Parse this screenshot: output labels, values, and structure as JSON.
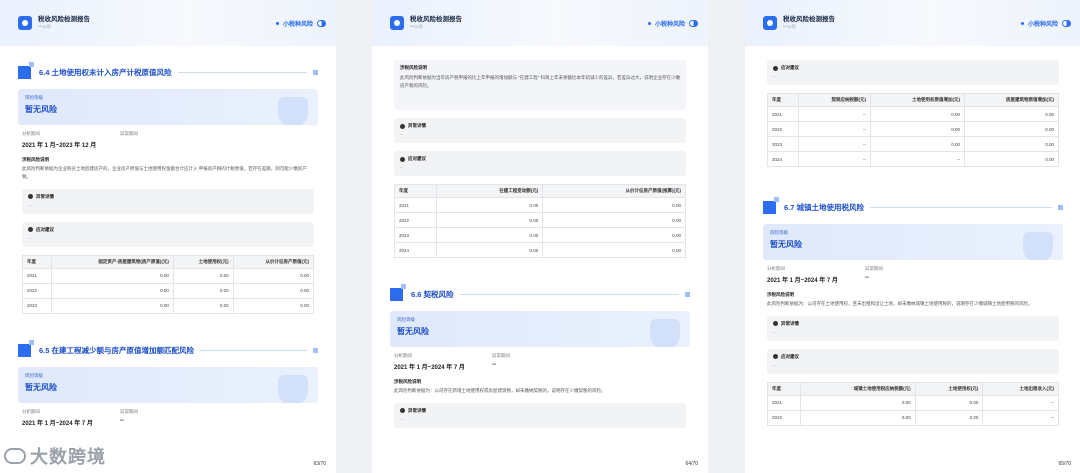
{
  "header": {
    "title": "税收风险检测报告",
    "subtitle": "***公司",
    "badge": "小税种风险"
  },
  "common": {
    "risk_level_label": "风险等级",
    "period_label": "分析期间",
    "abnormal_label": "异常期间",
    "desc_label": "涉税风险说明",
    "detail_label": "异常详情",
    "advice_label": "应对建议",
    "dash": "--"
  },
  "p1": {
    "sec1_title": "6.4 土地使用权未计入房产计税原值风险",
    "sec1_risk": "暂无风险",
    "sec1_period": "2021 年 1 月~2023 年 12 月",
    "sec1_abnormal": "",
    "sec1_desc": "此风险判断依据为企业购买土地后建房产的，企业房产原值与土地使用权金额合计应计入 申报房产税的计税原值，若存在差额，则可能少缴房产税。",
    "table_headers": [
      "年度",
      "固定资产-房屋建筑物(房产原值)(元)",
      "土地使用权(元)",
      "从价计征房产原值(元)"
    ],
    "table_rows": [
      [
        "2021",
        "0.00",
        "0.00",
        "0.00"
      ],
      [
        "2022",
        "0.00",
        "0.00",
        "0.00"
      ],
      [
        "2023",
        "0.00",
        "0.00",
        "0.00"
      ]
    ],
    "sec2_title": "6.5 在建工程减少额与房产原值增加额匹配风险",
    "sec2_risk": "暂无风险",
    "sec2_period": "2021 年 1 月~2024 年 7 月",
    "sec2_abnormal": "--",
    "page_number": "63/70"
  },
  "p2": {
    "desc": "此风险判断依据为当年房产税申报的比上年申报的增加额与 “在建工程” 科目上年末余额比本年初减少的差异，若差异过大，说明企业存在少缴房产税的风险。",
    "table_headers": [
      "年度",
      "在建工程变动额(元)",
      "从价计征房产原值(推算)(元)"
    ],
    "table_rows": [
      [
        "2021",
        "0.00",
        "0.00"
      ],
      [
        "2022",
        "0.00",
        "0.00"
      ],
      [
        "2023",
        "0.00",
        "0.00"
      ],
      [
        "2024",
        "0.00",
        "0.00"
      ]
    ],
    "sec_title": "6.6 契税风险",
    "risk": "暂无风险",
    "period": "2021 年 1 月~2024 年 7 月",
    "abnormal": "--",
    "sec_desc": "此风险判断依据为：公司存在新增土地使用权或房屋建筑物，却未缴纳契税的，说明存在少缴契税的风险。",
    "page_number": "64/70"
  },
  "p3": {
    "table1_headers": [
      "年度",
      "契税应纳税额(元)",
      "土地使用权原值增加(元)",
      "房屋建筑物原值增加(元)"
    ],
    "table1_rows": [
      [
        "2021",
        "--",
        "0.00",
        "0.00"
      ],
      [
        "2022",
        "--",
        "0.00",
        "0.00"
      ],
      [
        "2023",
        "--",
        "0.00",
        "0.00"
      ],
      [
        "2024",
        "--",
        "--",
        "0.00"
      ]
    ],
    "sec_title": "6.7 城镇土地使用税风险",
    "risk": "暂无风险",
    "period": "2021 年 1 月~2024 年 7 月",
    "abnormal": "--",
    "sec_desc": "此风险判断依据为：公司存在土地使用权，且未出租和出让土地，却未缴纳城镇土地使用税的，说明存在少缴城镇土地使用税的风险。",
    "table2_headers": [
      "年度",
      "城镇土地使用税应纳税额(元)",
      "土地使用权(元)",
      "土地出租收入(元)"
    ],
    "table2_rows": [
      [
        "2021",
        "0.00",
        "0.00",
        "--"
      ],
      [
        "2022",
        "0.00",
        "0.00",
        "--"
      ]
    ],
    "page_number": "65/70"
  },
  "watermark": "大数跨境"
}
